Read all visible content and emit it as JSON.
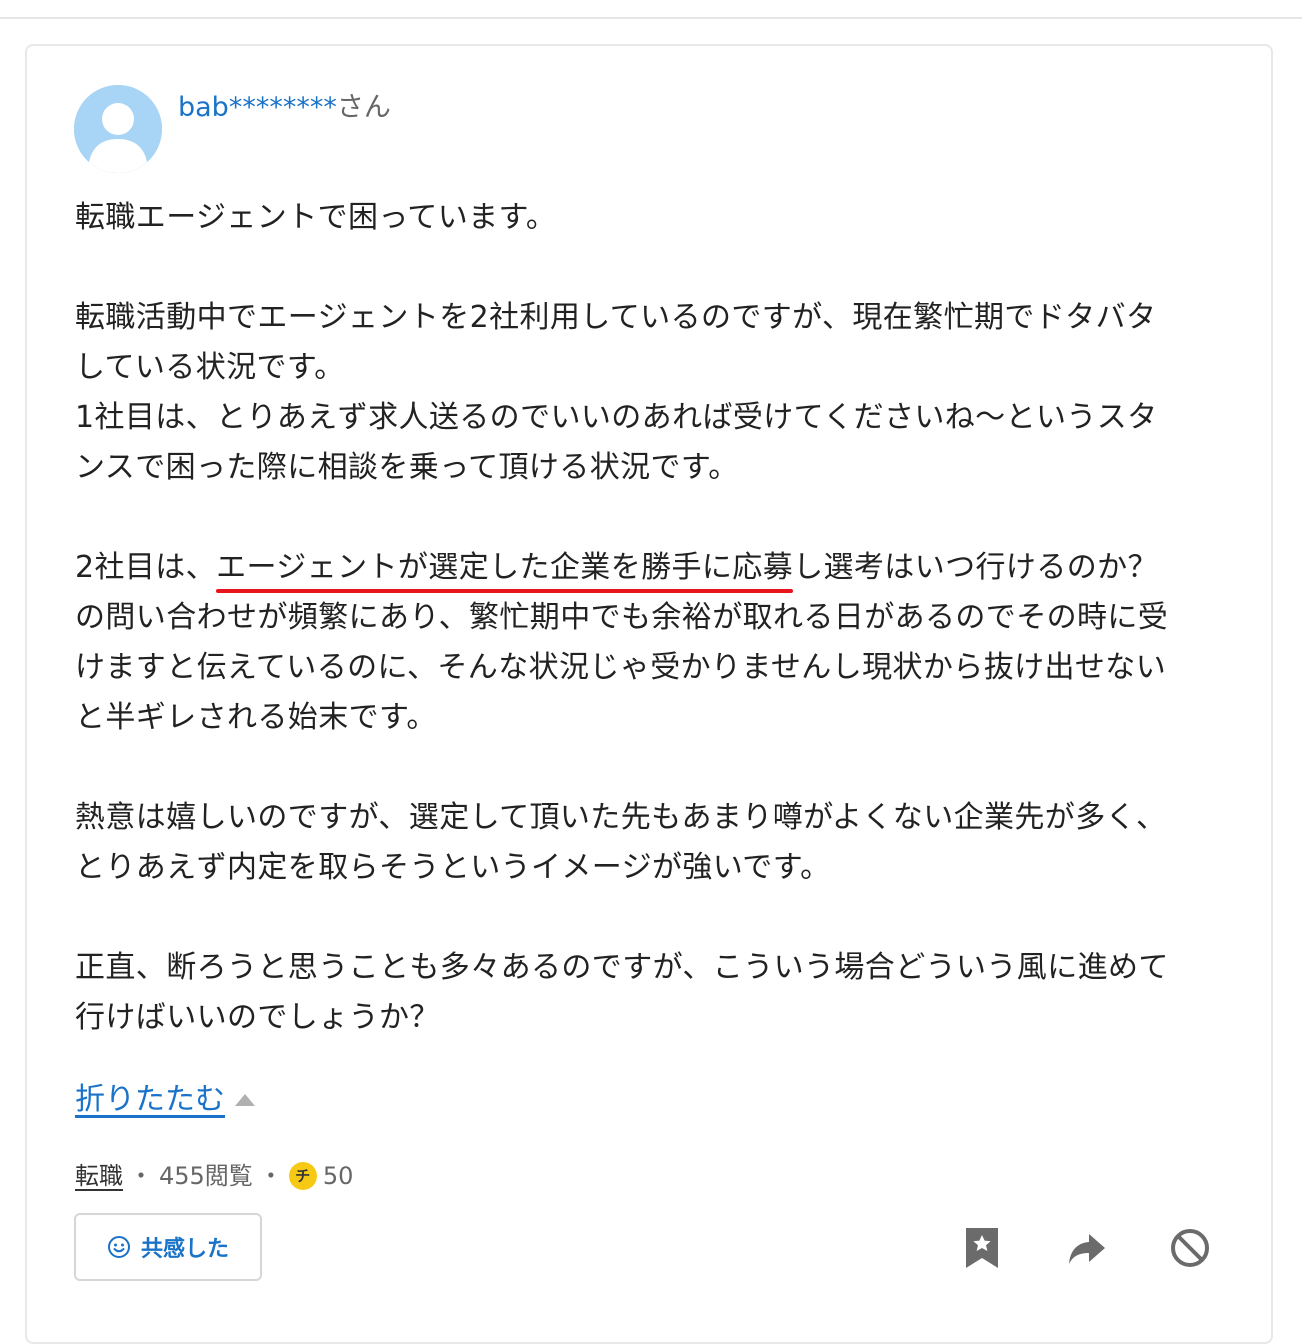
{
  "question": {
    "user": {
      "name": "bab********",
      "suffix": "さん"
    },
    "body": {
      "line1": "転職エージェントで困っています。",
      "line2": "転職活動中でエージェントを2社利用しているのですが、現在繁忙期でドタバタ",
      "line3": "している状況です。",
      "line4": "1社目は、とりあえず求人送るのでいいのあれば受けてくださいね〜というスタ",
      "line5": "ンスで困った際に相談を乗って頂ける状況です。",
      "line6_pre": "2社目は、",
      "line6_highlight": "エージェントが選定した企業を勝手に応募",
      "line6_post": "し選考はいつ行けるのか？",
      "line7": "の問い合わせが頻繁にあり、繁忙期中でも余裕が取れる日があるのでその時に受",
      "line8": "けますと伝えているのに、そんな状況じゃ受かりませんし現状から抜け出せない",
      "line9": "と半ギレされる始末です。",
      "line10": "熱意は嬉しいのですが、選定して頂いた先もあまり噂がよくない企業先が多く、",
      "line11": "とりあえず内定を取らそうというイメージが強いです。",
      "line12": "正直、断ろうと思うことも多々あるのですが、こういう場合どういう風に進めて",
      "line13": "行けばいいのでしょうか？"
    },
    "collapse_label": "折りたたむ",
    "meta": {
      "category": "転職",
      "views": "455閲覧",
      "separator": "・",
      "coin_glyph": "チ",
      "coins": "50"
    },
    "actions": {
      "empathy_label": "共感した"
    }
  },
  "colors": {
    "link": "#1a73c8",
    "highlight_underline": "#e8141c",
    "coin": "#f6c915"
  }
}
